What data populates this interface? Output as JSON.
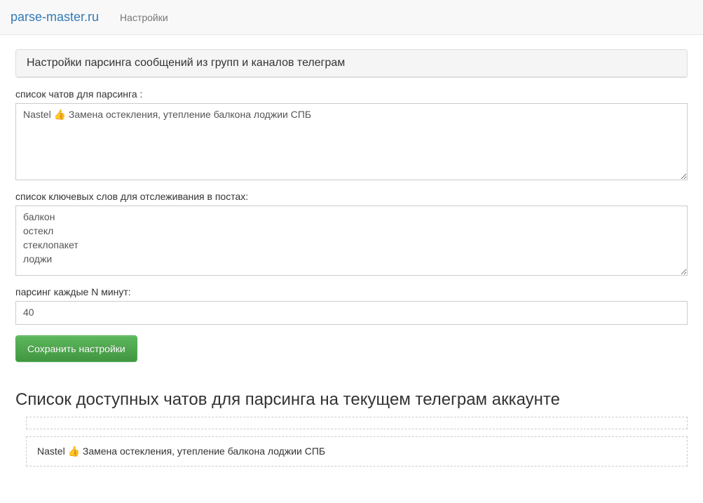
{
  "navbar": {
    "brand": "parse-master.ru",
    "settings_link": "Настройки"
  },
  "panel": {
    "title": "Настройки парсинга сообщений из групп и каналов телеграм"
  },
  "form": {
    "chats_label": "список чатов для парсинга :",
    "chats_value": "Nastel 👍 Замена остекления, утепление балкона лоджии СПБ",
    "keywords_label": "список ключевых слов для отслеживания в постах:",
    "keywords_value": "балкон\nостекл\nстеклопакет\nлоджи",
    "interval_label": "парсинг каждые N минут:",
    "interval_value": "40",
    "save_button": "Сохранить настройки"
  },
  "available_chats": {
    "header": "Список доступных чатов для парсинга на текущем телеграм аккаунте",
    "items": [
      "",
      "Nastel 👍 Замена остекления, утепление балкона лоджии СПБ"
    ]
  }
}
